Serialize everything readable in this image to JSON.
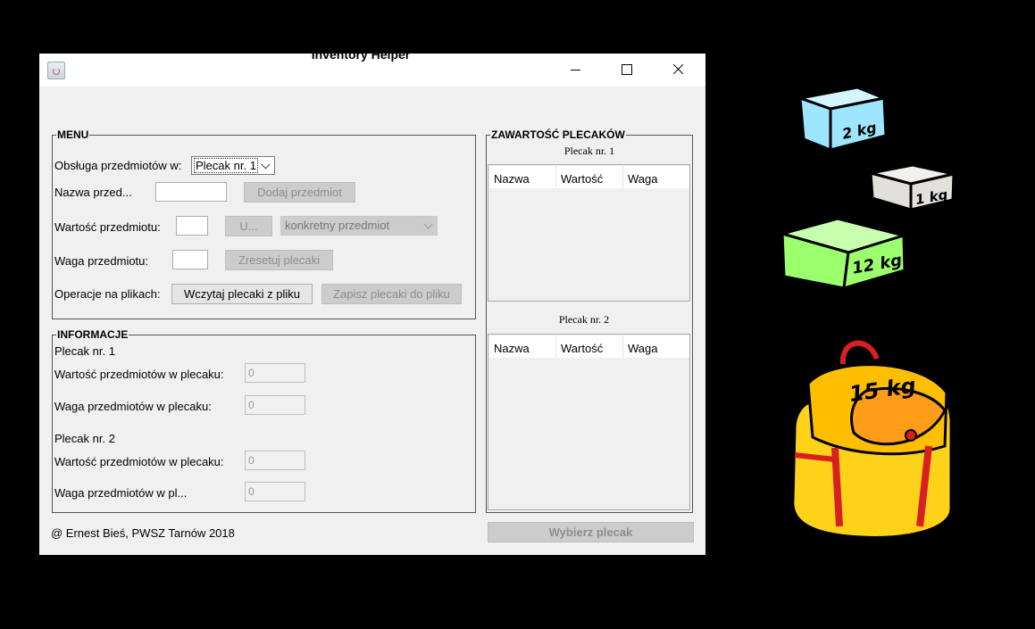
{
  "window": {
    "title": "Inventory Helper"
  },
  "menu": {
    "title": "MENU",
    "handling_label": "Obsługa przedmiotów w:",
    "backpack_select": "Plecak nr. 1",
    "name_label": "Nazwa przed...",
    "add_item_button": "Dodaj przedmiot",
    "value_label": "Wartość przedmiotu:",
    "u_button": "U...",
    "item_select": "konkretny przedmiot",
    "weight_label": "Waga przedmiotu:",
    "reset_button": "Zresetuj plecaki",
    "file_ops_label": "Operacje na plikach:",
    "load_button": "Wczytaj plecaki z pliku",
    "save_button": "Zapisz plecaki do pliku"
  },
  "info": {
    "title": "INFORMACJE",
    "backpack1_label": "Plecak nr. 1",
    "b1_value_label": "Wartość przedmiotów w plecaku:",
    "b1_value": "0",
    "b1_weight_label": "Waga przedmiotów w plecaku:",
    "b1_weight": "0",
    "backpack2_label": "Plecak nr. 2",
    "b2_value_label": "Wartość przedmiotów w plecaku:",
    "b2_value": "0",
    "b2_weight_label": "Waga przedmiotów w pl...",
    "b2_weight": "0"
  },
  "contents": {
    "title": "ZAWARTOŚĆ PLECAKÓW",
    "table1_caption": "Plecak nr. 1",
    "table2_caption": "Plecak nr. 2",
    "columns": [
      "Nazwa",
      "Wartość",
      "Waga"
    ]
  },
  "footer": {
    "copyright": "@ Ernest Bieś, PWSZ Tarnów 2018",
    "choose_button": "Wybierz plecak"
  },
  "artwork": {
    "box1": "2 kg",
    "box2": "1 kg",
    "box3": "12 kg",
    "backpack": "15 kg",
    "colors": {
      "box1": "#9ee6ff",
      "box2": "#e2e0dc",
      "box3": "#9cff6e",
      "backpack": "#ffd21a",
      "strap": "#d82020"
    }
  }
}
